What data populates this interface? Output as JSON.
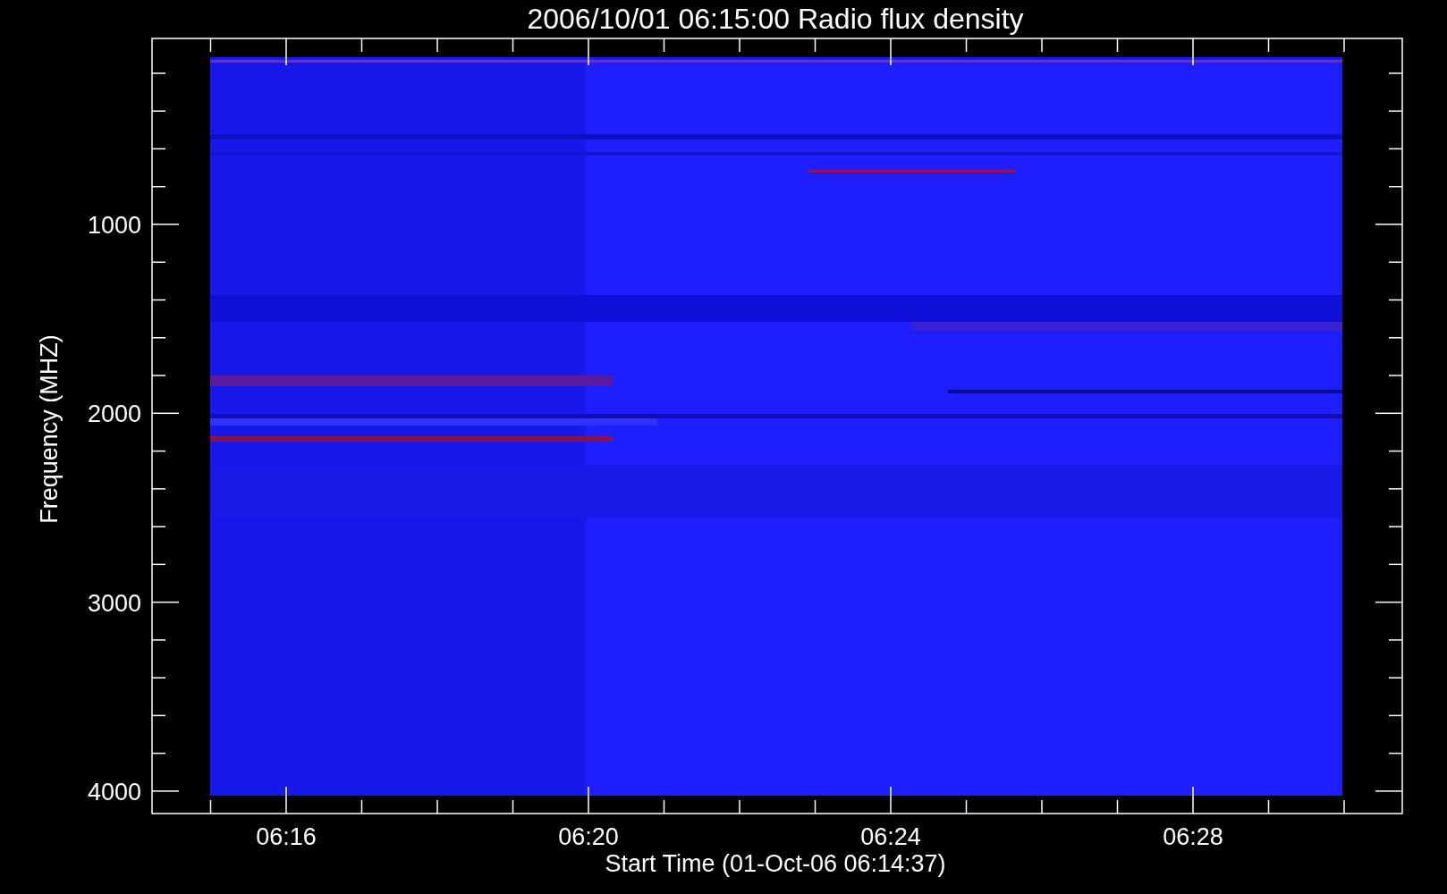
{
  "title": "2006/10/01 06:15:00 Radio flux density",
  "ylabel": "Frequency (MHZ)",
  "xlabel": "Start Time (01-Oct-06 06:14:37)",
  "yticks": [
    "1000",
    "2000",
    "3000",
    "4000"
  ],
  "xticks": [
    "06:16",
    "06:20",
    "06:24",
    "06:28"
  ]
}
